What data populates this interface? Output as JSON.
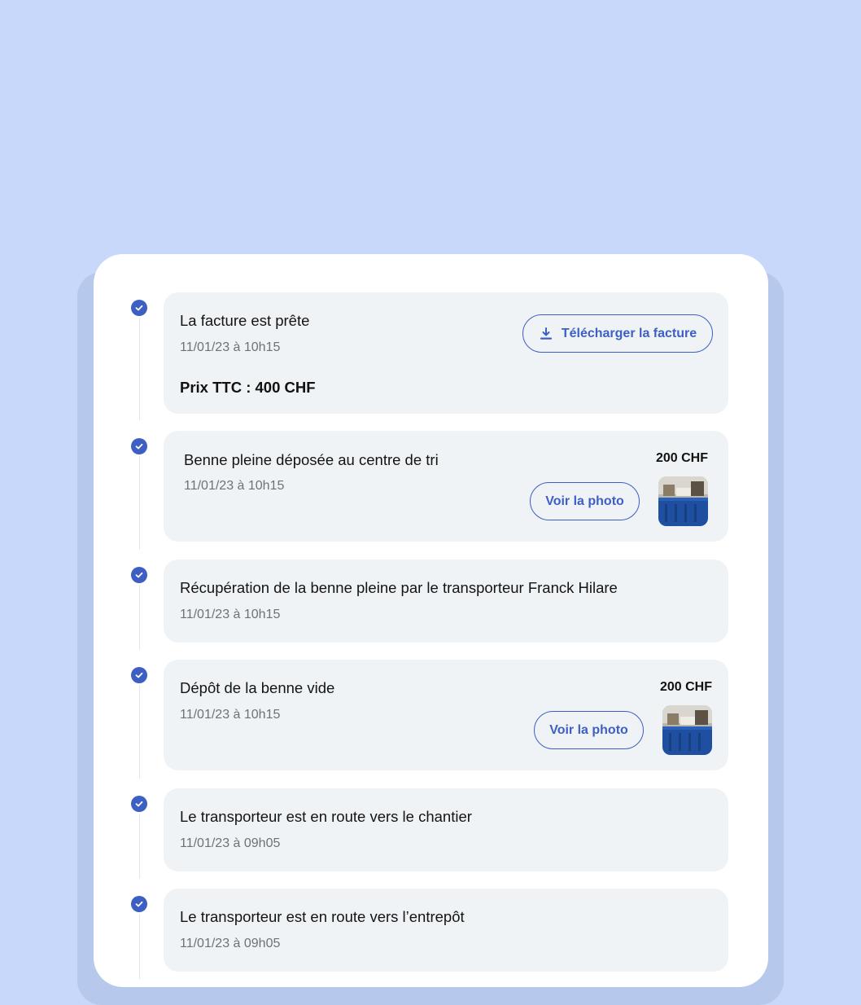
{
  "steps": [
    {
      "title": "La facture est prête",
      "date": "11/01/23 à 10h15",
      "price_line": "Prix TTC : 400 CHF",
      "download_label": "Télécharger la facture"
    },
    {
      "title": "Benne pleine déposée au centre de tri",
      "date": "11/01/23 à 10h15",
      "price": "200 CHF",
      "photo_label": "Voir la photo"
    },
    {
      "title": "Récupération de la benne pleine par le transporteur Franck Hilare",
      "date": "11/01/23 à 10h15"
    },
    {
      "title": "Dépôt de la benne vide",
      "date": "11/01/23 à 10h15",
      "price": "200 CHF",
      "photo_label": "Voir la photo"
    },
    {
      "title": "Le transporteur est en route vers le chantier",
      "date": "11/01/23 à 09h05"
    },
    {
      "title": "Le transporteur est en route vers l’entrepôt",
      "date": "11/01/23 à 09h05"
    }
  ],
  "colors": {
    "accent": "#3d5fc4",
    "background": "#c8d8fa",
    "card": "#f0f3f5"
  },
  "icons": [
    "check-icon",
    "download-icon"
  ]
}
